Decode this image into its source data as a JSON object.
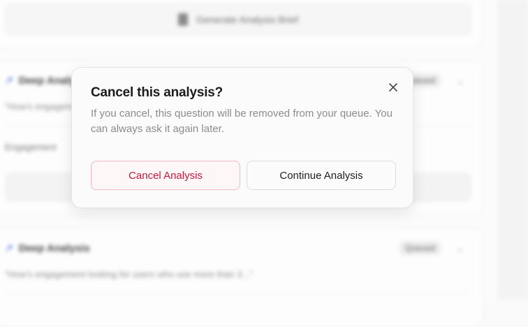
{
  "background": {
    "generate_label": "Generate Analysis Brief",
    "card2": {
      "title": "Deep Analysis",
      "badge": "Queued",
      "quote": "\"How's engagement looking for users who use more than 3...\"",
      "body": "Engagement"
    },
    "card3": {
      "title": "Deep Analysis",
      "badge": "Queued",
      "quote": "\"How's engagement looking for users who use more than 3...\""
    }
  },
  "modal": {
    "title": "Cancel this analysis?",
    "description": "If you cancel, this question will be removed from your queue. You can always ask it again later.",
    "close_icon": "close-icon",
    "cancel_label": "Cancel Analysis",
    "continue_label": "Continue Analysis"
  },
  "colors": {
    "danger": "#c4183c",
    "danger_border": "#f1b8c3",
    "accent_icon": "#4a6fe0"
  }
}
